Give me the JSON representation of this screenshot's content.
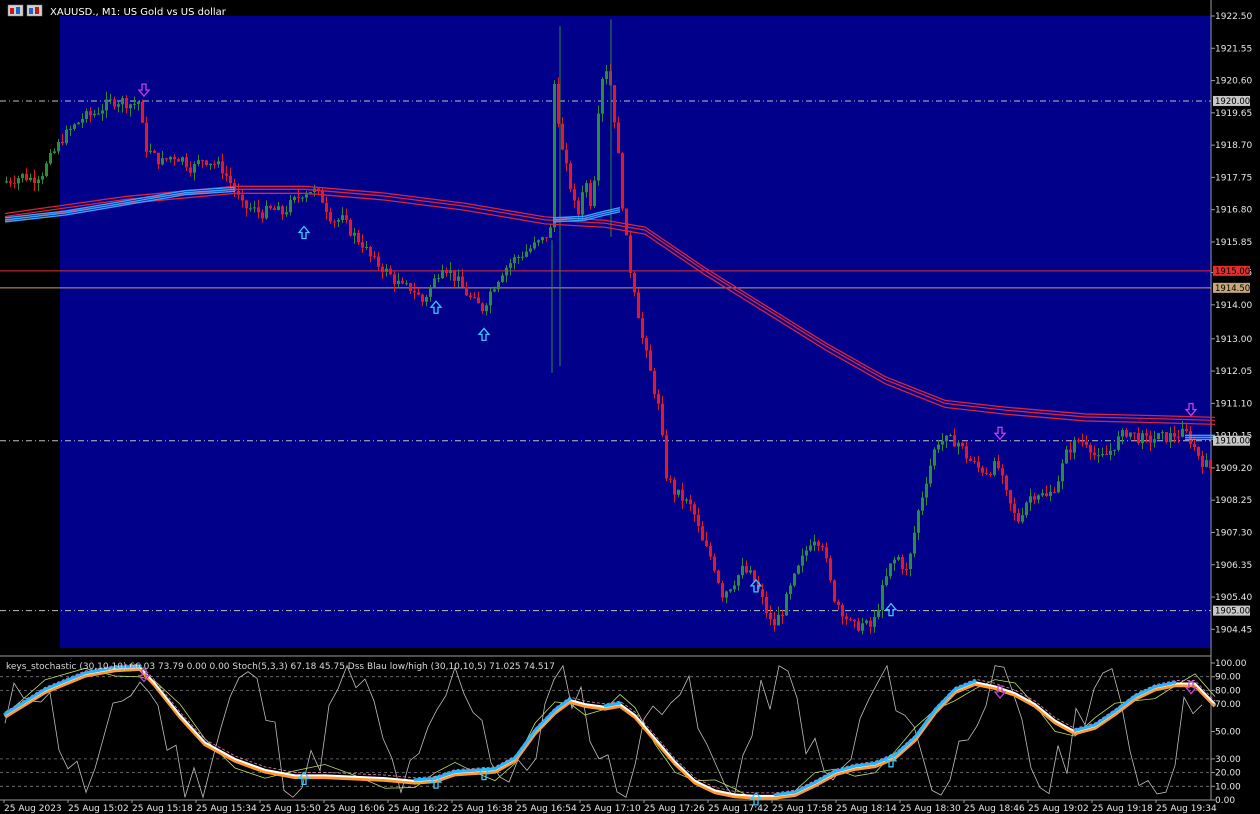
{
  "window": {
    "title": "XAUUSD., M1:  US Gold vs US dollar",
    "icon": "chart-window-icon"
  },
  "colors": {
    "main_bg": "#00008b",
    "frame_bg": "#000000",
    "bull": "#2e8b3a",
    "bear": "#e01b24",
    "ma_red": "#d9233f",
    "ma_blue": "#3aa0ff",
    "arrow_up": "#39c8ff",
    "arrow_down": "#c040e0",
    "stoch_orange": "#ff9a2e",
    "stoch_white": "#ffffff",
    "stoch_cyan": "#29b6ff",
    "hline_red": "#e03030",
    "hline_tan": "#c8a060"
  },
  "price_axis": {
    "ticks": [
      "1922.50",
      "1921.55",
      "1920.60",
      "1919.65",
      "1918.70",
      "1917.75",
      "1916.80",
      "1915.85",
      "1914.95",
      "1914.00",
      "1913.00",
      "1912.05",
      "1911.10",
      "1910.15",
      "1909.20",
      "1908.25",
      "1907.30",
      "1906.35",
      "1905.40",
      "1904.45"
    ],
    "tick_values": [
      1922.5,
      1921.55,
      1920.6,
      1919.65,
      1918.7,
      1917.75,
      1916.8,
      1915.85,
      1914.95,
      1914.0,
      1913.0,
      1912.05,
      1911.1,
      1910.15,
      1909.2,
      1908.25,
      1907.3,
      1906.35,
      1905.4,
      1904.45
    ],
    "ymax": 1922.5,
    "ymin": 1903.9
  },
  "level_lines": [
    {
      "label": "1920.00",
      "value": 1920.0,
      "kind": "dashdot",
      "badge": "#c8c8c8"
    },
    {
      "label": "1915.00",
      "value": 1915.0,
      "kind": "solid-red",
      "badge": "#e03030"
    },
    {
      "label": "1914.50",
      "value": 1914.5,
      "kind": "solid-tan",
      "badge": "#c8a878"
    },
    {
      "label": "1910.00",
      "value": 1910.0,
      "kind": "dashdot",
      "badge": "#c8c8c8"
    },
    {
      "label": "1905.00",
      "value": 1905.0,
      "kind": "dashdot",
      "badge": "#c8c8c8"
    }
  ],
  "indicator": {
    "label": "keys_stochastic (30,10,10) 66.03 73.79 0.00 0.00 Stoch(5,3,3) 67.18 45.75 Dss Blau low/high (30,10,10,5) 71.025 74.517",
    "ticks": [
      "100.00",
      "90.00",
      "80.00",
      "70.00",
      "50.00",
      "30.00",
      "20.00",
      "10.00",
      "0.00"
    ],
    "tick_values": [
      100,
      90,
      80,
      70,
      50,
      30,
      20,
      10,
      0
    ]
  },
  "time_axis": [
    "25 Aug 2023",
    "25 Aug 15:02",
    "25 Aug 15:18",
    "25 Aug 15:34",
    "25 Aug 15:50",
    "25 Aug 16:06",
    "25 Aug 16:22",
    "25 Aug 16:38",
    "25 Aug 16:54",
    "25 Aug 17:10",
    "25 Aug 17:26",
    "25 Aug 17:42",
    "25 Aug 17:58",
    "25 Aug 18:14",
    "25 Aug 18:30",
    "25 Aug 18:46",
    "25 Aug 19:02",
    "25 Aug 19:18",
    "25 Aug 19:34"
  ],
  "chart_data": {
    "type": "candlestick",
    "symbol": "XAUUSD.",
    "timeframe": "M1",
    "price_path": [
      [
        0,
        1917.6
      ],
      [
        10,
        1917.7
      ],
      [
        20,
        1917.8
      ],
      [
        30,
        1917.7
      ],
      [
        40,
        1917.9
      ],
      [
        50,
        1918.4
      ],
      [
        60,
        1918.9
      ],
      [
        70,
        1919.2
      ],
      [
        80,
        1919.5
      ],
      [
        90,
        1919.6
      ],
      [
        100,
        1919.8
      ],
      [
        110,
        1920.0
      ],
      [
        120,
        1920.0
      ],
      [
        130,
        1919.9
      ],
      [
        137,
        1920.0
      ],
      [
        142,
        1918.7
      ],
      [
        150,
        1918.4
      ],
      [
        160,
        1918.2
      ],
      [
        170,
        1918.4
      ],
      [
        180,
        1918.3
      ],
      [
        190,
        1918.0
      ],
      [
        200,
        1918.3
      ],
      [
        210,
        1918.2
      ],
      [
        220,
        1918.0
      ],
      [
        230,
        1917.5
      ],
      [
        240,
        1916.9
      ],
      [
        250,
        1916.8
      ],
      [
        260,
        1916.7
      ],
      [
        270,
        1916.8
      ],
      [
        280,
        1916.7
      ],
      [
        290,
        1917.0
      ],
      [
        300,
        1917.3
      ],
      [
        310,
        1917.4
      ],
      [
        320,
        1917.1
      ],
      [
        330,
        1916.5
      ],
      [
        340,
        1916.5
      ],
      [
        350,
        1916.1
      ],
      [
        360,
        1915.8
      ],
      [
        370,
        1915.3
      ],
      [
        380,
        1915.1
      ],
      [
        390,
        1914.8
      ],
      [
        400,
        1914.5
      ],
      [
        410,
        1914.5
      ],
      [
        420,
        1914.1
      ],
      [
        430,
        1914.6
      ],
      [
        440,
        1915.2
      ],
      [
        450,
        1914.9
      ],
      [
        460,
        1914.5
      ],
      [
        470,
        1914.1
      ],
      [
        480,
        1913.9
      ],
      [
        490,
        1914.5
      ],
      [
        500,
        1915.0
      ],
      [
        510,
        1915.3
      ],
      [
        520,
        1915.5
      ],
      [
        530,
        1915.7
      ],
      [
        540,
        1915.9
      ],
      [
        548,
        1916.2
      ],
      [
        552,
        1920.5
      ],
      [
        560,
        1918.5
      ],
      [
        568,
        1917.5
      ],
      [
        575,
        1916.5
      ],
      [
        582,
        1917.8
      ],
      [
        590,
        1916.8
      ],
      [
        596,
        1919.8
      ],
      [
        602,
        1921.2
      ],
      [
        608,
        1920.5
      ],
      [
        614,
        1919.0
      ],
      [
        620,
        1917.0
      ],
      [
        626,
        1915.3
      ],
      [
        632,
        1914.5
      ],
      [
        640,
        1913.0
      ],
      [
        648,
        1912.0
      ],
      [
        656,
        1911.0
      ],
      [
        664,
        1909.0
      ],
      [
        672,
        1908.5
      ],
      [
        680,
        1908.3
      ],
      [
        690,
        1908.0
      ],
      [
        700,
        1907.0
      ],
      [
        710,
        1906.5
      ],
      [
        720,
        1905.5
      ],
      [
        730,
        1905.8
      ],
      [
        740,
        1906.2
      ],
      [
        750,
        1906.0
      ],
      [
        760,
        1905.3
      ],
      [
        770,
        1904.5
      ],
      [
        780,
        1905.0
      ],
      [
        790,
        1905.8
      ],
      [
        800,
        1906.5
      ],
      [
        810,
        1907.2
      ],
      [
        820,
        1907.0
      ],
      [
        830,
        1905.5
      ],
      [
        840,
        1905.0
      ],
      [
        850,
        1904.5
      ],
      [
        860,
        1904.6
      ],
      [
        870,
        1904.5
      ],
      [
        880,
        1905.6
      ],
      [
        888,
        1906.3
      ],
      [
        895,
        1906.6
      ],
      [
        905,
        1906.1
      ],
      [
        915,
        1907.8
      ],
      [
        925,
        1909.0
      ],
      [
        935,
        1910.0
      ],
      [
        945,
        1910.0
      ],
      [
        955,
        1910.0
      ],
      [
        965,
        1909.5
      ],
      [
        975,
        1909.2
      ],
      [
        985,
        1909.1
      ],
      [
        995,
        1909.3
      ],
      [
        1005,
        1908.3
      ],
      [
        1015,
        1907.6
      ],
      [
        1025,
        1908.3
      ],
      [
        1035,
        1908.5
      ],
      [
        1045,
        1908.3
      ],
      [
        1055,
        1908.8
      ],
      [
        1065,
        1909.7
      ],
      [
        1075,
        1910.0
      ],
      [
        1085,
        1910.0
      ],
      [
        1095,
        1909.4
      ],
      [
        1105,
        1909.6
      ],
      [
        1115,
        1910.0
      ],
      [
        1125,
        1910.3
      ],
      [
        1135,
        1910.1
      ],
      [
        1145,
        1910.0
      ],
      [
        1155,
        1910.1
      ],
      [
        1165,
        1910.1
      ],
      [
        1175,
        1910.2
      ],
      [
        1185,
        1910.2
      ],
      [
        1192,
        1909.8
      ],
      [
        1200,
        1909.4
      ],
      [
        1207,
        1909.2
      ]
    ],
    "wicks": [
      [
        555,
        1922.2,
        1912.2
      ],
      [
        606,
        1922.4,
        1916.0
      ],
      [
        547,
        1915.9,
        1912.0
      ]
    ],
    "moving_averages": {
      "red": [
        [
          0,
          1916.6
        ],
        [
          120,
          1917.1
        ],
        [
          230,
          1917.4
        ],
        [
          300,
          1917.4
        ],
        [
          380,
          1917.2
        ],
        [
          460,
          1916.9
        ],
        [
          540,
          1916.5
        ],
        [
          600,
          1916.4
        ],
        [
          640,
          1916.2
        ],
        [
          700,
          1915.0
        ],
        [
          760,
          1913.9
        ],
        [
          820,
          1912.8
        ],
        [
          880,
          1911.8
        ],
        [
          940,
          1911.1
        ],
        [
          1000,
          1910.9
        ],
        [
          1080,
          1910.7
        ],
        [
          1150,
          1910.65
        ],
        [
          1210,
          1910.6
        ]
      ],
      "blue": [
        [
          0,
          1916.5
        ],
        [
          60,
          1916.7
        ],
        [
          120,
          1917.0
        ],
        [
          180,
          1917.3
        ],
        [
          230,
          1917.4
        ]
      ],
      "blue2": [
        [
          548,
          1916.5
        ],
        [
          580,
          1916.55
        ],
        [
          600,
          1916.7
        ],
        [
          615,
          1916.8
        ]
      ],
      "blue3": [
        [
          1180,
          1910.1
        ],
        [
          1210,
          1910.1
        ]
      ]
    },
    "signal_arrows_up": [
      [
        299,
        1916.6
      ],
      [
        431,
        1914.4
      ],
      [
        479,
        1913.6
      ],
      [
        751,
        1906.2
      ],
      [
        886,
        1905.5
      ]
    ],
    "signal_arrows_down": [
      [
        139,
        1920.2
      ],
      [
        995,
        1910.1
      ],
      [
        1186,
        1910.8
      ]
    ],
    "stochastic": [
      [
        0,
        62
      ],
      [
        40,
        80
      ],
      [
        80,
        92
      ],
      [
        110,
        96
      ],
      [
        135,
        97
      ],
      [
        150,
        85
      ],
      [
        175,
        62
      ],
      [
        200,
        42
      ],
      [
        230,
        30
      ],
      [
        260,
        22
      ],
      [
        290,
        18
      ],
      [
        320,
        18
      ],
      [
        350,
        17
      ],
      [
        380,
        16
      ],
      [
        410,
        14
      ],
      [
        430,
        15
      ],
      [
        450,
        20
      ],
      [
        470,
        21
      ],
      [
        490,
        22
      ],
      [
        510,
        30
      ],
      [
        530,
        50
      ],
      [
        550,
        65
      ],
      [
        565,
        73
      ],
      [
        580,
        70
      ],
      [
        600,
        68
      ],
      [
        615,
        70
      ],
      [
        630,
        62
      ],
      [
        650,
        45
      ],
      [
        670,
        28
      ],
      [
        690,
        14
      ],
      [
        710,
        7
      ],
      [
        730,
        4
      ],
      [
        750,
        3
      ],
      [
        770,
        3
      ],
      [
        790,
        5
      ],
      [
        810,
        12
      ],
      [
        830,
        20
      ],
      [
        850,
        24
      ],
      [
        870,
        26
      ],
      [
        890,
        32
      ],
      [
        910,
        45
      ],
      [
        930,
        65
      ],
      [
        950,
        80
      ],
      [
        970,
        86
      ],
      [
        990,
        83
      ],
      [
        1010,
        78
      ],
      [
        1030,
        70
      ],
      [
        1050,
        58
      ],
      [
        1070,
        50
      ],
      [
        1090,
        54
      ],
      [
        1110,
        64
      ],
      [
        1130,
        75
      ],
      [
        1150,
        82
      ],
      [
        1170,
        85
      ],
      [
        1190,
        85
      ],
      [
        1210,
        70
      ]
    ]
  }
}
